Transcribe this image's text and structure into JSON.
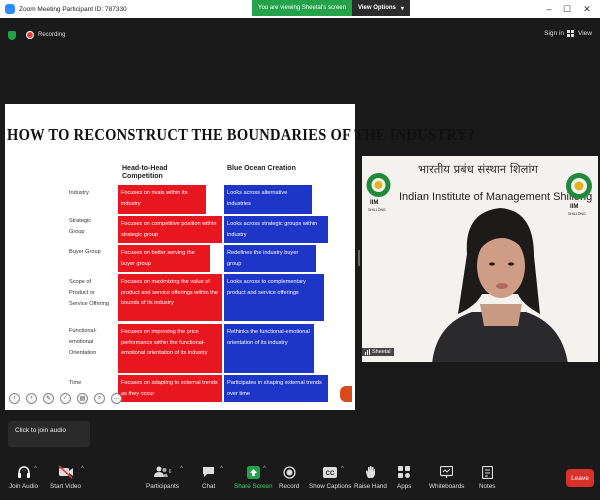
{
  "window": {
    "title": "Zoom Meeting Participant ID: 787330",
    "banner_text": "You are viewing Sheetal's screen",
    "view_options_label": "View Options"
  },
  "meeting_header": {
    "recording_label": "Recording",
    "signin_label": "Sign in",
    "view_label": "View"
  },
  "slide": {
    "title": "HOW TO RECONSTRUCT THE BOUNDARIES OF THE INDUSTRY?",
    "col_heads": [
      "Head-to-Head\nCompetition",
      "Blue Ocean Creation"
    ],
    "rows": [
      {
        "label": "Industry",
        "red": "Focuses on rivals within its industry",
        "blue": "Looks across alternative industries"
      },
      {
        "label": "Strategic Group",
        "red": "Focuses on competitive position within strategic group",
        "blue": "Looks across strategic groups within industry"
      },
      {
        "label": "Buyer Group",
        "red": "Focuses on better serving the buyer group",
        "blue": "Redefines the industry buyer group"
      },
      {
        "label": "Scope of Product or Service Offering",
        "red": "Focuses on maximizing the value of product and service offerings within the bounds of its industry",
        "blue": "Looks across to complementary product and service offerings"
      },
      {
        "label": "Functional-emotional Orientation",
        "red": "Focuses on improving the price performance within the functional-emotional orientation of its industry",
        "blue": "Rethinks the functional-emotional orientation of its industry"
      },
      {
        "label": "Time",
        "red": "Focuses on adapting to external trends as they occur",
        "blue": "Participates in shaping external trends over time"
      }
    ],
    "colors": {
      "red": "#e8161e",
      "blue": "#1e36c8"
    }
  },
  "video": {
    "hindi_title": "भारतीय प्रबंध संस्थान शिलांग",
    "institute_name": "Indian Institute of Management Shillong",
    "logo_abbr": "IIM",
    "logo_city": "SHILLONG",
    "participant_name": "Sheetal"
  },
  "tooltip": {
    "text": "Click to join audio"
  },
  "toolbar": {
    "join_audio": "Join Audio",
    "start_video": "Start Video",
    "participants": "Participants",
    "participants_count": "6",
    "chat": "Chat",
    "share_screen": "Share Screen",
    "record": "Record",
    "show_captions": "Show Captions",
    "raise_hand": "Raise Hand",
    "apps": "Apps",
    "whiteboards": "Whiteboards",
    "notes": "Notes",
    "leave": "Leave"
  }
}
